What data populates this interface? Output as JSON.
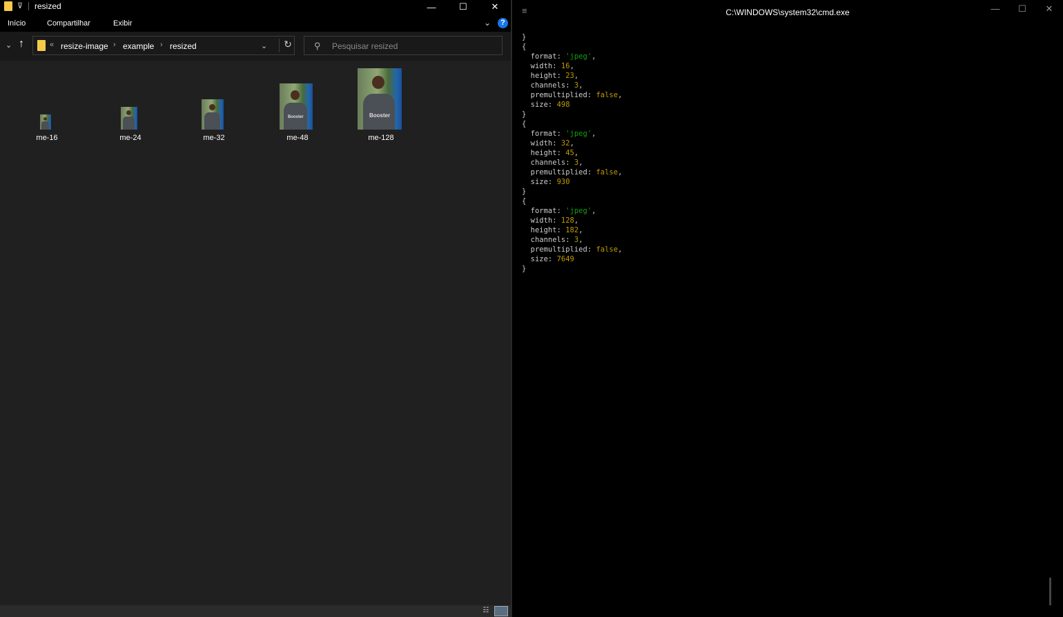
{
  "explorer": {
    "title": "resized",
    "ribbon_tabs": [
      "Início",
      "Compartilhar",
      "Exibir"
    ],
    "help_label": "?",
    "breadcrumb": [
      "resize-image",
      "example",
      "resized"
    ],
    "breadcrumb_prefix": "«",
    "search_placeholder": "Pesquisar resized",
    "files": [
      {
        "name": "me-16"
      },
      {
        "name": "me-24"
      },
      {
        "name": "me-32"
      },
      {
        "name": "me-48"
      },
      {
        "name": "me-128"
      }
    ],
    "thumbnail_text": "Booster"
  },
  "cmd": {
    "title": "C:\\WINDOWS\\system32\\cmd.exe",
    "objects": [
      {
        "format": "'jpeg'",
        "width": "16",
        "height": "23",
        "channels": "3",
        "premultiplied": "false",
        "size": "498"
      },
      {
        "format": "'jpeg'",
        "width": "32",
        "height": "45",
        "channels": "3",
        "premultiplied": "false",
        "size": "930"
      },
      {
        "format": "'jpeg'",
        "width": "128",
        "height": "182",
        "channels": "3",
        "premultiplied": "false",
        "size": "7649"
      }
    ]
  },
  "colors": {
    "explorer_bg": "#202020",
    "cmd_bg": "#000000",
    "string": "#13a10e",
    "number": "#c19c00",
    "folder": "#f7c948"
  }
}
